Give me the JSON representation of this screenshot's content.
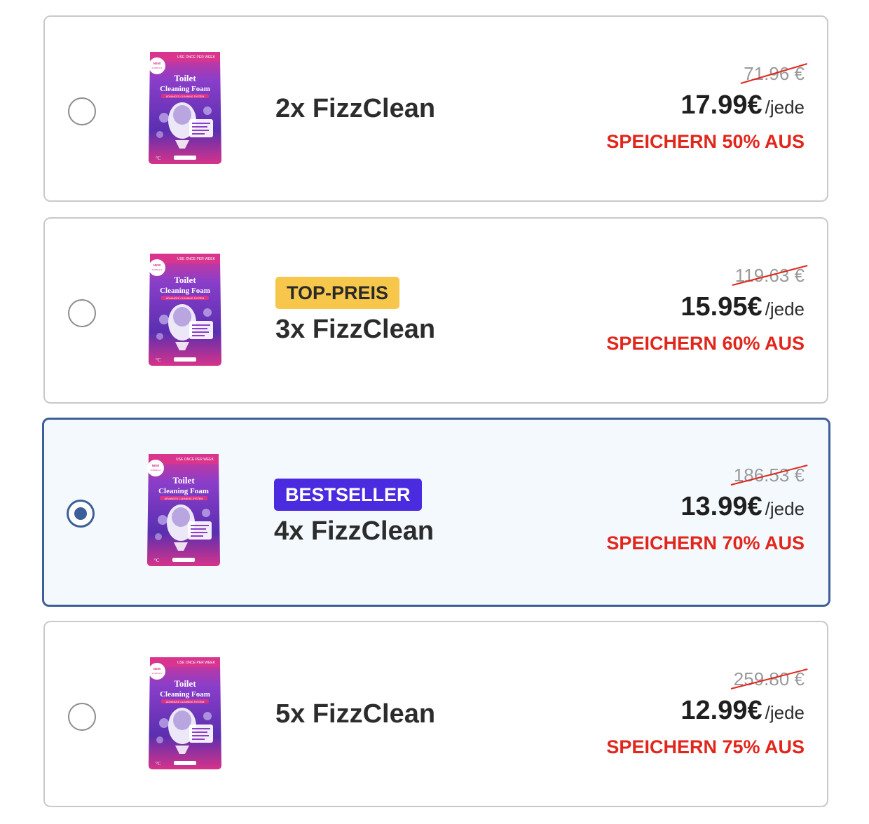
{
  "options": [
    {
      "badge": "",
      "title": "2x FizzClean",
      "old_price": "71.96 €",
      "new_price": "17.99€",
      "unit": "/jede",
      "savings": "SPEICHERN 50% AUS",
      "selected": false
    },
    {
      "badge": "TOP-PREIS",
      "title": "3x FizzClean",
      "old_price": "119.63 €",
      "new_price": "15.95€",
      "unit": "/jede",
      "savings": "SPEICHERN 60% AUS",
      "selected": false
    },
    {
      "badge": "BESTSELLER",
      "title": "4x FizzClean",
      "old_price": "186.53 €",
      "new_price": "13.99€",
      "unit": "/jede",
      "savings": "SPEICHERN 70% AUS",
      "selected": true
    },
    {
      "badge": "",
      "title": "5x FizzClean",
      "old_price": "259.80 €",
      "new_price": "12.99€",
      "unit": "/jede",
      "savings": "SPEICHERN 75% AUS",
      "selected": false
    }
  ],
  "product_image": {
    "top_line": "USE ONCE PER WEEK",
    "corner_badge": "NEW ENHANCED FORMULA",
    "name_line1": "Toilet",
    "name_line2": "Cleaning Foam",
    "subtitle": "ADVANCED CLEANING SYSTEM",
    "icon": "toilet-foam-pouch-icon"
  },
  "colors": {
    "selected_border": "#3d5f99",
    "selected_bg": "#f4f9fe",
    "savings_red": "#e1261c",
    "badge_top": "#f7c74c",
    "badge_best": "#4a2be0",
    "pouch_pink": "#d6338a",
    "pouch_purple": "#6b2fb3"
  }
}
